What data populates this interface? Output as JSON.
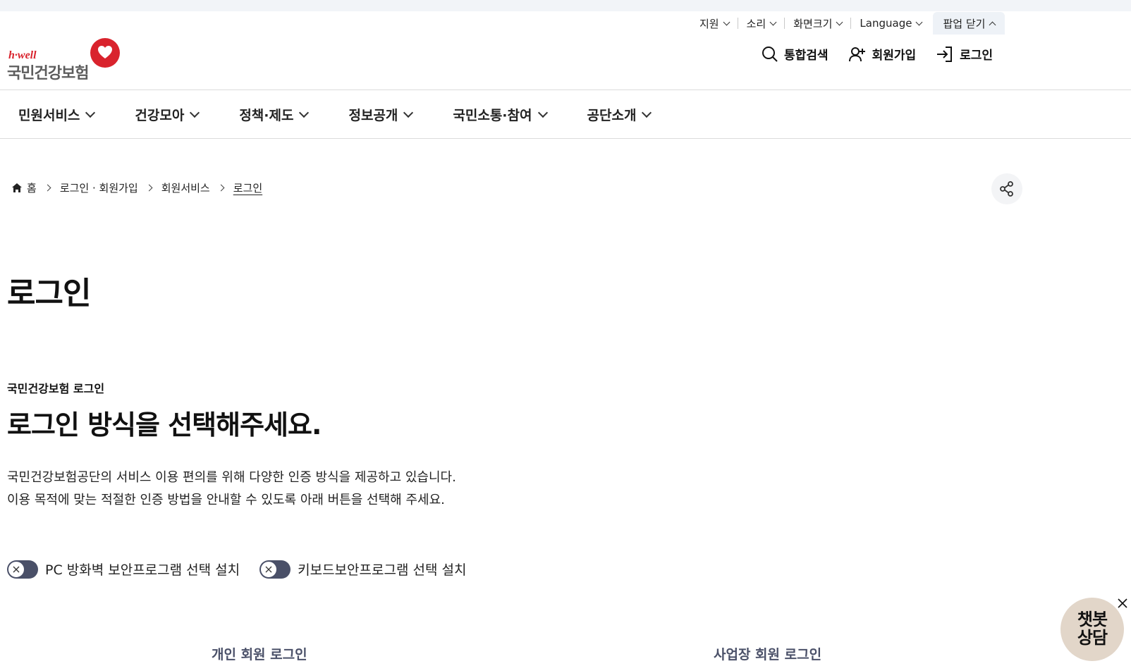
{
  "utility_bar": {
    "support": "지원",
    "sound": "소리",
    "screen_size": "화면크기",
    "language": "Language",
    "popup_close": "팝업 닫기"
  },
  "logo": {
    "brand_en": "h·well",
    "brand_ko": "국민건강보험",
    "brand_color": "#d9232d"
  },
  "header_actions": {
    "search": "통합검색",
    "signup": "회원가입",
    "login": "로그인"
  },
  "gnb": [
    {
      "label": "민원서비스"
    },
    {
      "label": "건강모아"
    },
    {
      "label": "정책·제도"
    },
    {
      "label": "정보공개"
    },
    {
      "label": "국민소통·참여"
    },
    {
      "label": "공단소개"
    }
  ],
  "breadcrumb": {
    "home": "홈",
    "items": [
      "로그인 · 회원가입",
      "회원서비스",
      "로그인"
    ]
  },
  "page_title": "로그인",
  "section": {
    "subtitle": "국민건강보험 로그인",
    "title": "로그인 방식을 선택해주세요.",
    "desc_line1": "국민건강보험공단의 서비스 이용 편의를 위해 다양한 인증 방식을 제공하고 있습니다.",
    "desc_line2": "이용 목적에 맞는 적절한 인증 방법을 안내할 수 있도록 아래 버튼을 선택해 주세요."
  },
  "toggles": [
    {
      "label": "PC 방화벽 보안프로그램 선택 설치"
    },
    {
      "label": "키보드보안프로그램 선택 설치"
    }
  ],
  "login_tabs": {
    "personal": "개인 회원 로그인",
    "business": "사업장 회원 로그인"
  },
  "chatbot": {
    "line1": "챗봇",
    "line2": "상담"
  },
  "colors": {
    "toggle_track": "#4a5068",
    "chatbot_bg": "#e2d6c9"
  }
}
